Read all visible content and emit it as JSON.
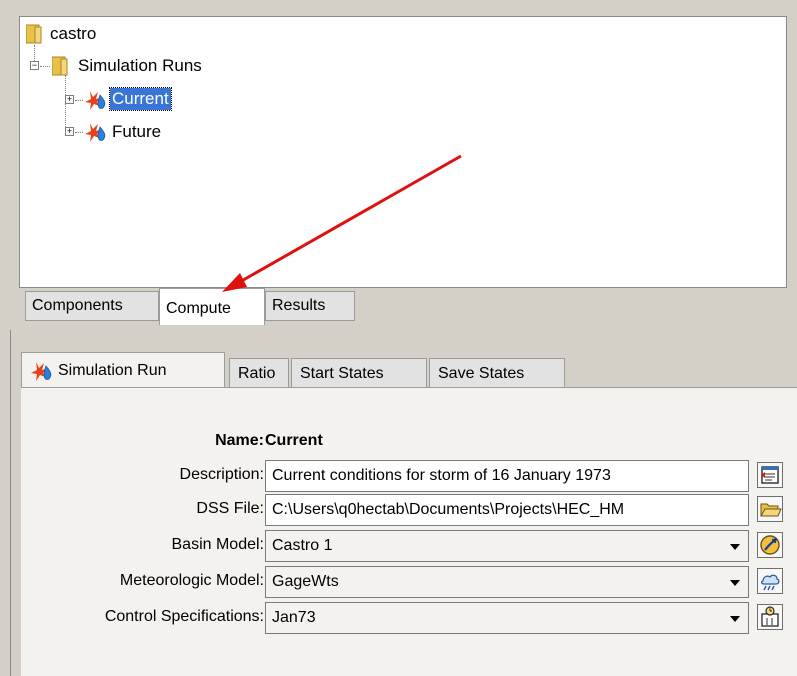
{
  "tree": {
    "root": {
      "label": "castro"
    },
    "group": {
      "label": "Simulation Runs"
    },
    "runs": [
      {
        "label": "Current",
        "selected": true
      },
      {
        "label": "Future",
        "selected": false
      }
    ]
  },
  "top_tabs": [
    {
      "label": "Components"
    },
    {
      "label": "Compute",
      "active": true
    },
    {
      "label": "Results"
    }
  ],
  "sub_tabs": [
    {
      "label": "Simulation Run",
      "active": true
    },
    {
      "label": "Ratio"
    },
    {
      "label": "Start States"
    },
    {
      "label": "Save States"
    }
  ],
  "form": {
    "name_label": "Name:",
    "name_value": "Current",
    "description_label": "Description:",
    "description_value": "Current conditions for storm of 16 January 1973",
    "dss_label": "DSS File:",
    "dss_value": "C:\\Users\\q0hectab\\Documents\\Projects\\HEC_HM",
    "basin_label": "Basin Model:",
    "basin_value": "Castro 1",
    "met_label": "Meteorologic Model:",
    "met_value": "GageWts",
    "control_label": "Control Specifications:",
    "control_value": "Jan73"
  },
  "colors": {
    "annotation_arrow": "#e01010",
    "selection": "#3875d7",
    "folder": "#e8c04a"
  }
}
